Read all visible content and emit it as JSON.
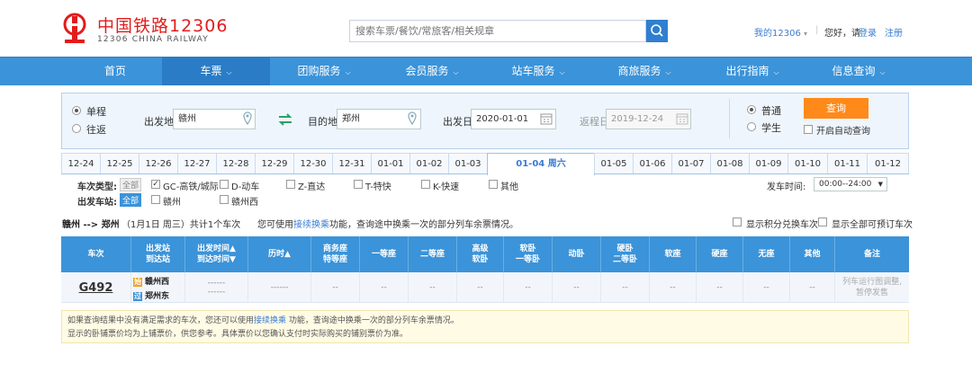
{
  "header": {
    "logo_title": "中国铁路12306",
    "logo_sub": "12306 CHINA RAILWAY",
    "search_placeholder": "搜索车票/餐饮/常旅客/相关规章",
    "my_account": "我的12306",
    "greeting": "您好，请",
    "login": "登录",
    "register": "注册"
  },
  "nav": {
    "items": [
      {
        "label": "首页",
        "caret": false
      },
      {
        "label": "车票",
        "caret": true
      },
      {
        "label": "团购服务",
        "caret": true
      },
      {
        "label": "会员服务",
        "caret": true
      },
      {
        "label": "站车服务",
        "caret": true
      },
      {
        "label": "商旅服务",
        "caret": true
      },
      {
        "label": "出行指南",
        "caret": true
      },
      {
        "label": "信息查询",
        "caret": true
      }
    ]
  },
  "query": {
    "one_way": "单程",
    "round_trip": "往返",
    "from_label": "出发地",
    "from_value": "赣州",
    "to_label": "目的地",
    "to_value": "郑州",
    "depart_label": "出发日",
    "depart_value": "2020-01-01",
    "return_label": "返程日",
    "return_value": "2019-12-24",
    "normal": "普通",
    "student": "学生",
    "query_btn": "查询",
    "auto_query": "开启自动查询"
  },
  "dates": [
    "12-24",
    "12-25",
    "12-26",
    "12-27",
    "12-28",
    "12-29",
    "12-30",
    "12-31",
    "01-01",
    "01-02",
    "01-03",
    "01-04 周六",
    "01-05",
    "01-06",
    "01-07",
    "01-08",
    "01-09",
    "01-10",
    "01-11",
    "01-12"
  ],
  "filters": {
    "type_label": "车次类型:",
    "all": "全部",
    "types": [
      "GC-高铁/城际",
      "D-动车",
      "Z-直达",
      "T-特快",
      "K-快速",
      "其他"
    ],
    "station_label": "出发车站:",
    "stations": [
      "赣州",
      "赣州西"
    ],
    "time_label": "发车时间:",
    "time_value": "00:00--24:00"
  },
  "summary": {
    "route": "赣州 --> 郑州",
    "date": "（1月1日 周三）共计1个车次",
    "tip_prefix": "您可使用",
    "tip_link": "接续换乘",
    "tip_suffix": "功能，查询途中换乘一次的部分列车余票情况。",
    "opt_points": "显示积分兑换车次",
    "opt_all": "显示全部可预订车次"
  },
  "table": {
    "headers": [
      "车次",
      "出发站\n到达站",
      "出发时间▲\n到达时间▼",
      "历时▲",
      "商务座\n特等座",
      "一等座",
      "二等座",
      "高级\n软卧",
      "软卧\n一等卧",
      "动卧",
      "硬卧\n二等卧",
      "软座",
      "硬座",
      "无座",
      "其他",
      "备注"
    ],
    "row": {
      "train": "G492",
      "from_icon": "始",
      "from": "赣州西",
      "to_icon": "过",
      "to": "郑州东",
      "dep": "------",
      "arr": "------",
      "dur": "------",
      "seat": "--",
      "remark": "列车运行图调整,暂停发售"
    }
  },
  "note": {
    "line1_prefix": "如果查询结果中没有满足需求的车次，您还可以使用",
    "line1_link": "接续换乘",
    "line1_suffix": " 功能，查询途中换乘一次的部分列车余票情况。",
    "line2": "显示的卧铺票价均为上铺票价，供您参考。具体票价以您确认支付时实际购买的铺别票价为准。"
  },
  "colors": {
    "brand_red": "#e21c1c",
    "nav_blue": "#3b93d9",
    "link_blue": "#3b7cd3",
    "query_orange": "#ff8a1a"
  }
}
